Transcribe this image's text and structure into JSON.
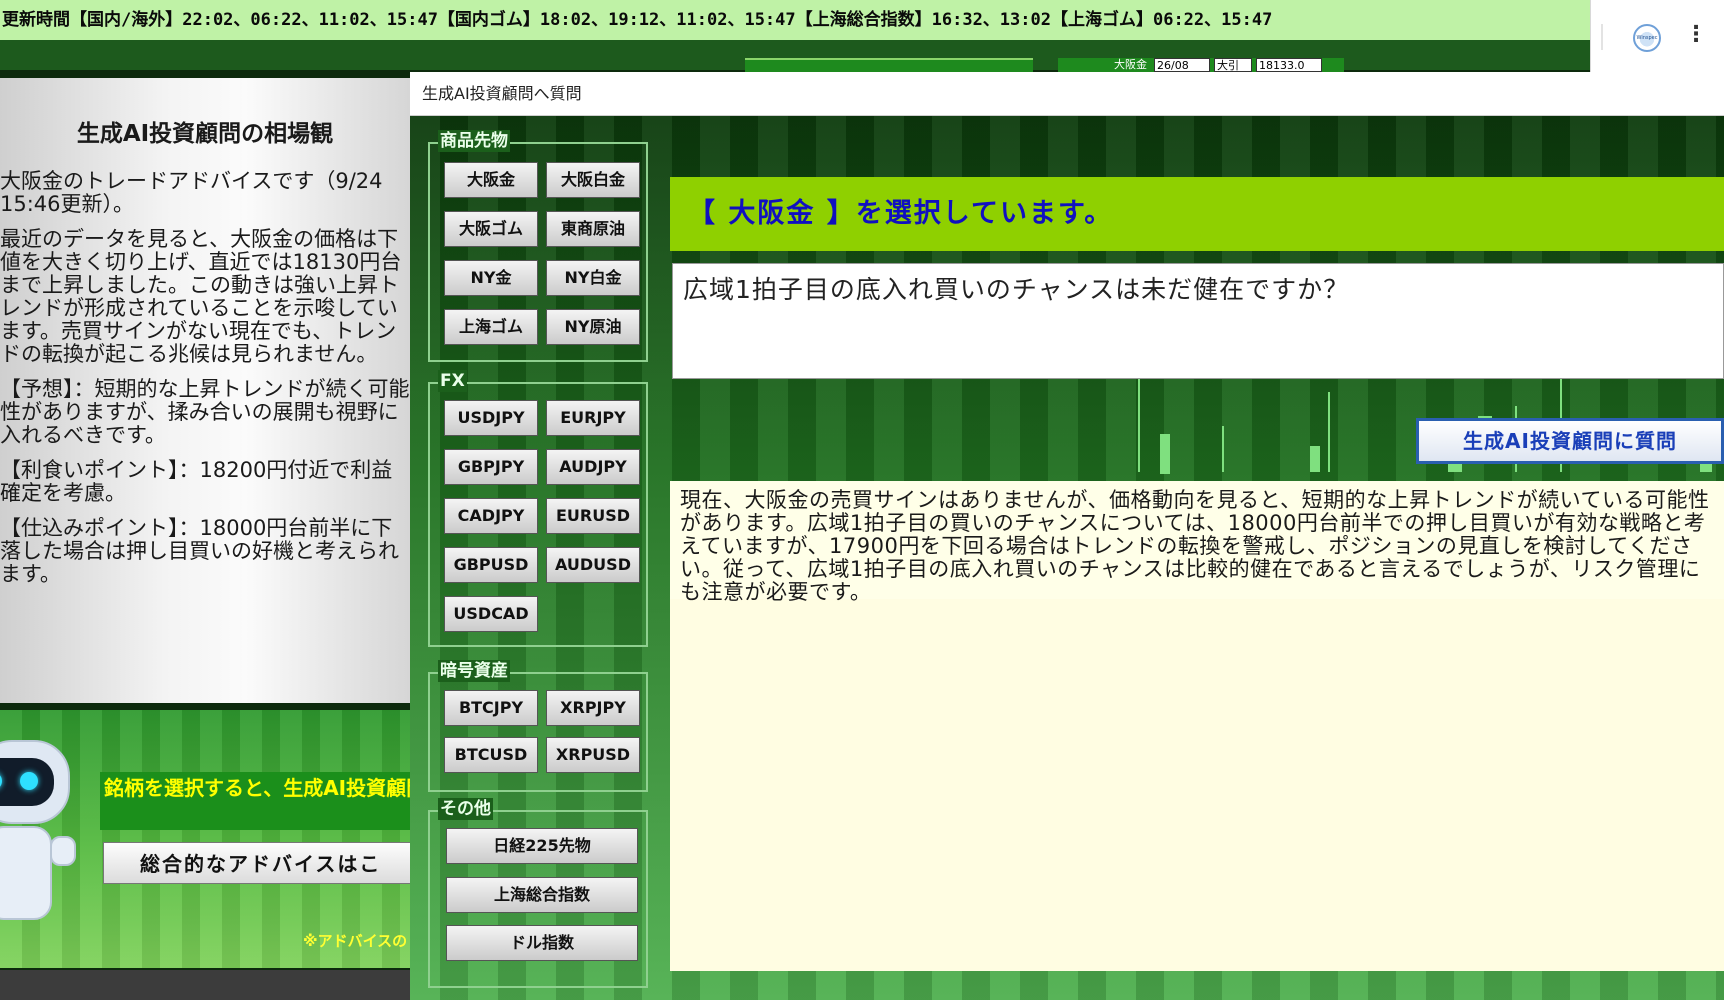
{
  "ticker": {
    "text": "更新時間【国内/海外】22:02、06:22、11:02、15:47【国内ゴム】18:02、19:12、11:02、15:47【上海総合指数】16:32、13:02【上海ゴム】06:22、15:47"
  },
  "extension": {
    "icon_name": "winspec-extension-icon",
    "icon_label": "Winspec"
  },
  "background": {
    "widget_label": "大阪金",
    "cells": [
      "26/08",
      "大引",
      "18133.0"
    ]
  },
  "left_panel": {
    "title": "生成AI投資顧問の相場観",
    "paragraphs": [
      "大阪金のトレードアドバイスです（9/24 15:46更新）。",
      "最近のデータを見ると、大阪金の価格は下値を大きく切り上げ、直近では18130円台まで上昇しました。この動きは強い上昇トレンドが形成されていることを示唆しています。売買サインがない現在でも、トレンドの転換が起こる兆候は見られません。",
      "【予想】：短期的な上昇トレンドが続く可能性がありますが、揉み合いの展開も視野に入れるべきです。",
      "【利食いポイント】：18200円付近で利益確定を考慮。",
      "【仕込みポイント】：18000円台前半に下落した場合は押し目買いの好機と考えられます。"
    ],
    "bottom": {
      "message": "銘柄を選択すると、生成AI投資顧問からのアドバイスが表示されます。",
      "button_label": "総合的なアドバイスはこ",
      "note": "※アドバイスの"
    }
  },
  "dialog": {
    "title": "生成AI投資顧問へ質問",
    "groups": {
      "commodities": {
        "label": "商品先物",
        "items": [
          "大阪金",
          "大阪白金",
          "大阪ゴム",
          "東商原油",
          "NY金",
          "NY白金",
          "上海ゴム",
          "NY原油"
        ]
      },
      "fx": {
        "label": "FX",
        "items": [
          "USDJPY",
          "EURJPY",
          "GBPJPY",
          "AUDJPY",
          "CADJPY",
          "EURUSD",
          "GBPUSD",
          "AUDUSD",
          "USDCAD"
        ]
      },
      "crypto": {
        "label": "暗号資産",
        "items": [
          "BTCJPY",
          "XRPJPY",
          "BTCUSD",
          "XRPUSD"
        ]
      },
      "other": {
        "label": "その他",
        "items": [
          "日経225先物",
          "上海総合指数",
          "ドル指数"
        ]
      }
    },
    "selected_banner": "【 大阪金 】を選択しています。",
    "question_value": "広域1拍子目の底入れ買いのチャンスは未だ健在ですか？",
    "ask_button_label": "生成AI投資顧問に質問",
    "answer": "現在、大阪金の売買サインはありませんが、価格動向を見ると、短期的な上昇トレンドが続いている可能性があります。広域1拍子目の買いのチャンスについては、18000円台前半での押し目買いが有効な戦略と考えていますが、17900円を下回る場合はトレンドの転換を警戒し、ポジションの見直しを検討してください。従って、広域1拍子目の底入れ買いのチャンスは比較的健在であると言えるでしょうが、リスク管理にも注意が必要です。"
  }
}
